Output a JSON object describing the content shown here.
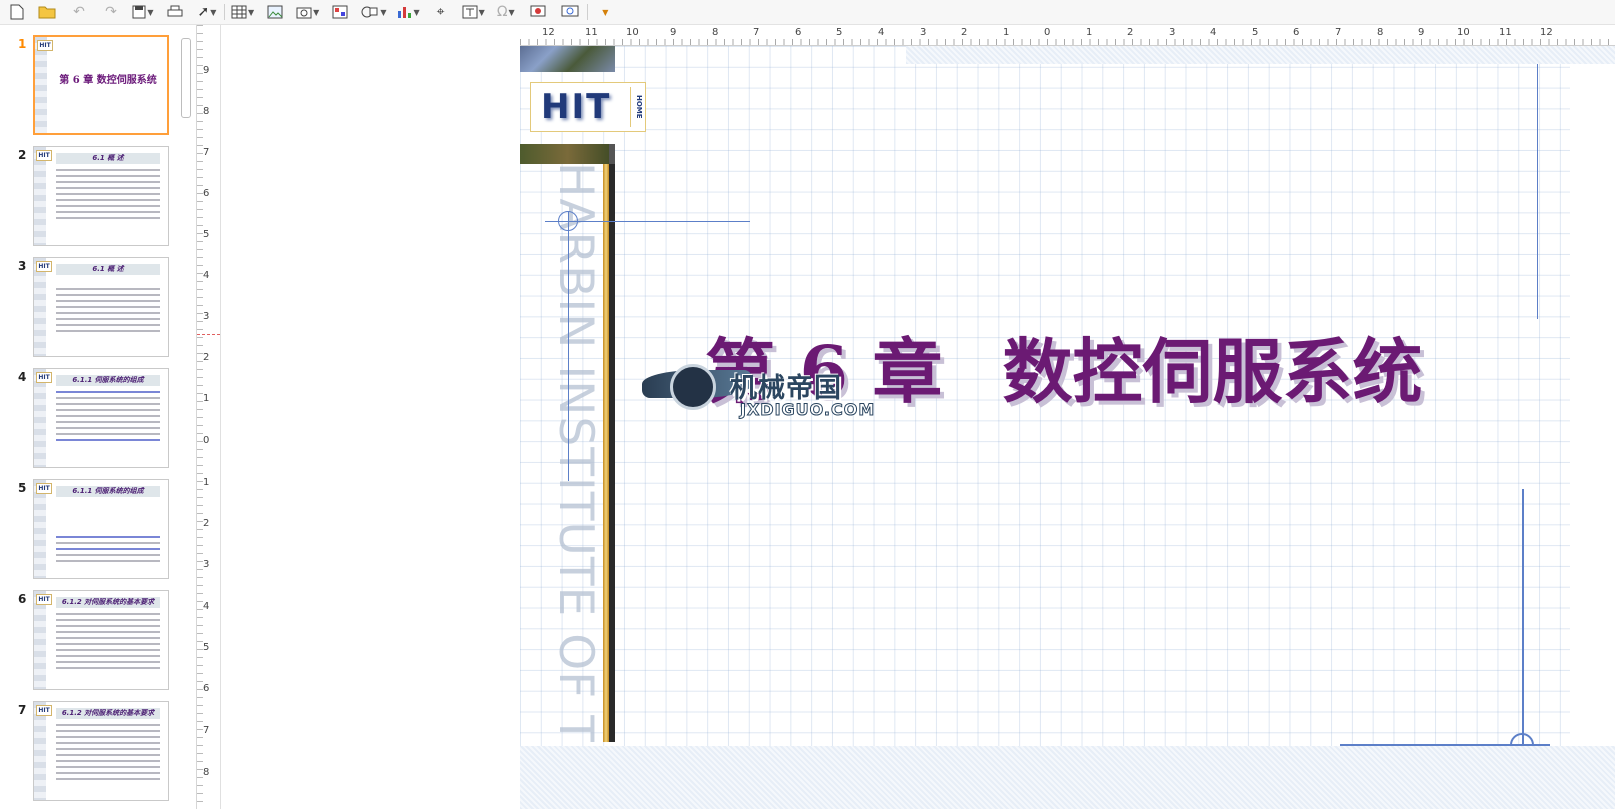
{
  "toolbar": {
    "items": [
      "new-document",
      "open",
      "undo",
      "redo",
      "save",
      "print",
      "select",
      "table",
      "image",
      "media",
      "chart-image",
      "shapes",
      "bar-chart",
      "cursor-text",
      "text-box",
      "special-character",
      "slideshow",
      "display"
    ]
  },
  "slides": [
    {
      "num": "1",
      "title": "第 6 章   数控伺服系统",
      "active": true
    },
    {
      "num": "2",
      "title": "6.1    概    述"
    },
    {
      "num": "3",
      "title": "6.1    概    述"
    },
    {
      "num": "4",
      "title": "6.1.1   伺服系统的组成"
    },
    {
      "num": "5",
      "title": "6.1.1   伺服系统的组成"
    },
    {
      "num": "6",
      "title": "6.1.2  对伺服系统的基本要求"
    },
    {
      "num": "7",
      "title": "6.1.2  对伺服系统的基本要求"
    }
  ],
  "thumb_logo": "HIT",
  "vruler": {
    "labels": [
      "9",
      "8",
      "7",
      "6",
      "5",
      "4",
      "3",
      "2",
      "1",
      "0",
      "1",
      "2",
      "3",
      "4",
      "5",
      "6",
      "7",
      "8"
    ]
  },
  "hruler": {
    "labels": [
      "12",
      "11",
      "10",
      "9",
      "8",
      "7",
      "6",
      "5",
      "4",
      "3",
      "2",
      "1",
      "0",
      "1",
      "2",
      "3",
      "4",
      "5",
      "6",
      "7",
      "8",
      "9",
      "10",
      "11",
      "12"
    ]
  },
  "slide": {
    "logo": "HIT",
    "logo_sub": "HOME",
    "vertical_text": "HARBIN INSTITUTE OF TECHNOLOGY",
    "title_chapter": "第 6 章",
    "title_main": "数控伺服系统",
    "watermark_cn": "机械帝国",
    "watermark_en": "JXDIGUO.COM"
  }
}
